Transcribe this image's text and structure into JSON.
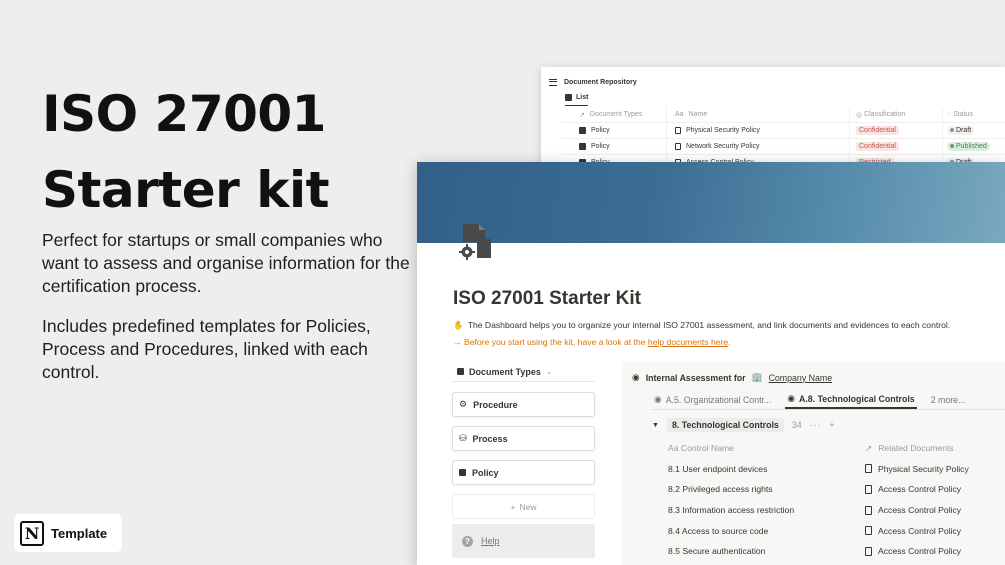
{
  "promo": {
    "title_line1": "ISO 27001",
    "title_line2": "Starter kit",
    "paragraph1": "Perfect for startups or small companies who want to assess and organise information for the certification process.",
    "paragraph2": "Includes predefined templates for Policies, Process and Procedures, linked with each control.",
    "badge_label": "Template"
  },
  "repository": {
    "title": "Document Repository",
    "view_tab": "List",
    "columns": [
      "Document Types",
      "Name",
      "Classification",
      "Status"
    ],
    "rows": [
      {
        "type": "Policy",
        "name": "Physical Security Policy",
        "classification": "Confidential",
        "status": "Draft"
      },
      {
        "type": "Policy",
        "name": "Network Security Policy",
        "classification": "Confidential",
        "status": "Published"
      },
      {
        "type": "Policy",
        "name": "Access Control Policy",
        "classification": "Restricted",
        "status": "Draft"
      }
    ]
  },
  "page": {
    "title": "ISO 27001 Starter Kit",
    "description": "The Dashboard helps you to organize your internal ISO 27001 assessment, and link documents and evidences to each control.",
    "warning_prefix": "→ Before you start using the kit, have a look at the",
    "warning_link": "help documents here",
    "warning_suffix": "."
  },
  "document_types": {
    "header": "Document Types",
    "items": [
      "Procedure",
      "Process",
      "Policy"
    ],
    "new_label": "New",
    "help_label": "Help"
  },
  "assessment": {
    "header_prefix": "Internal Assessment for",
    "company": "Company Name",
    "tabs": [
      "A.5. Organizational Contr...",
      "A.8. Technological Controls",
      "2 more..."
    ],
    "group_name": "8. Technological Controls",
    "group_count": "34",
    "group_more": "···",
    "group_add": "+",
    "columns": [
      "Control Name",
      "Related Documents"
    ],
    "rows": [
      {
        "control": "8.1 User endpoint devices",
        "doc": "Physical Security Policy"
      },
      {
        "control": "8.2 Privileged access rights",
        "doc": "Access Control Policy"
      },
      {
        "control": "8.3 Information access restriction",
        "doc": "Access Control Policy"
      },
      {
        "control": "8.4 Access to source code",
        "doc": "Access Control Policy"
      },
      {
        "control": "8.5 Secure authentication",
        "doc": "Access Control Policy"
      }
    ]
  },
  "colors": {
    "cover_start": "#315f88",
    "cover_end": "#79a9bf",
    "warning": "#d9730d",
    "confidential_tag": "#fbe4e4",
    "published_tag": "#dbeddb"
  }
}
